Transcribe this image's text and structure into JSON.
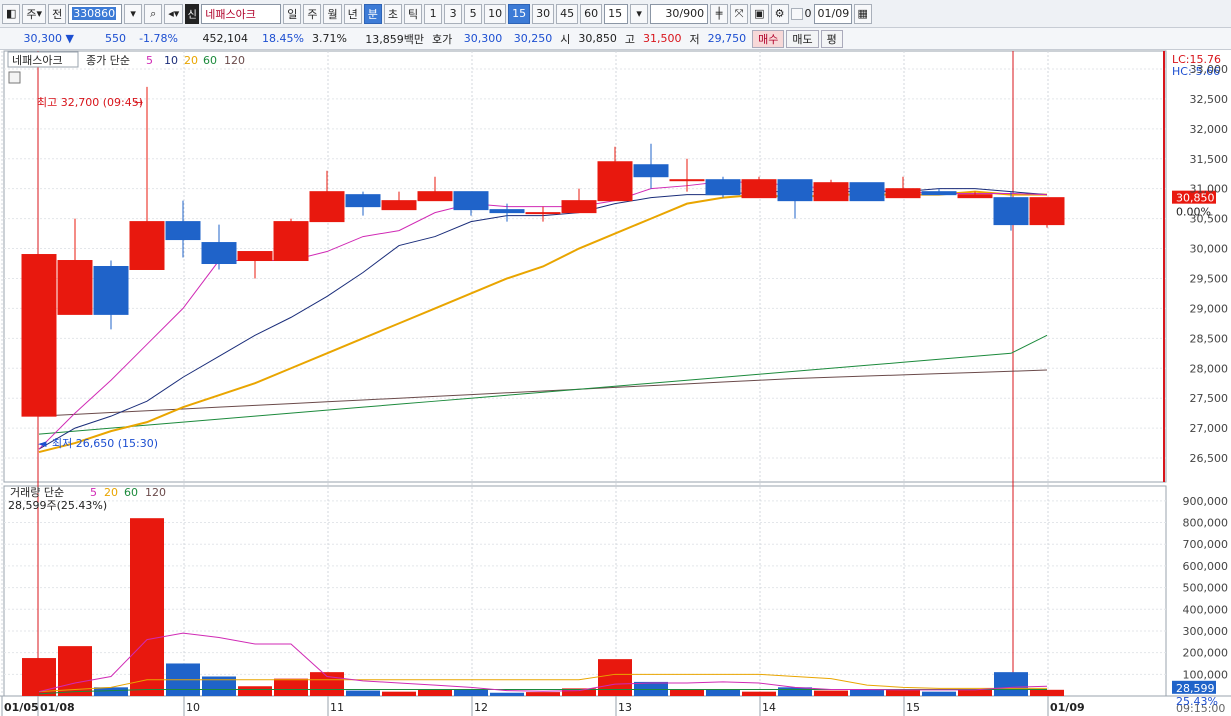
{
  "toolbar": {
    "mode": "주",
    "prev_label": "전",
    "code": "330860",
    "shin": "신",
    "name": "네패스아크",
    "periods": [
      "일",
      "주",
      "월",
      "년",
      "분",
      "초",
      "틱"
    ],
    "selected_period": "분",
    "minutes": [
      "1",
      "3",
      "5",
      "10",
      "15",
      "30",
      "45",
      "60"
    ],
    "selected_minute": "15",
    "interval_value": "15",
    "count": "30",
    "count_total": "/900",
    "date": "01/09",
    "checkbox_label": "0"
  },
  "quote": {
    "price": "30,300",
    "change": "550",
    "change_pct": "-1.78%",
    "volume": "452,104",
    "turnover_pct": "18.45%",
    "pct2": "3.71%",
    "amount": "13,859백만",
    "hoga_label": "호가",
    "ask": "30,300",
    "bid": "30,250",
    "open_label": "시",
    "open": "30,850",
    "high_label": "고",
    "high": "31,500",
    "low_label": "저",
    "low": "29,750",
    "buy": "매수",
    "sell": "매도",
    "avg": "평"
  },
  "price_panel": {
    "stock_tag": "네패스아크",
    "legend_prefix": "종가 단순",
    "ma_periods": [
      "5",
      "10",
      "20",
      "60",
      "120"
    ],
    "lc": "LC:15.76",
    "hc": "HC:-5.66",
    "max_label": "최고 32,700 (09:45)",
    "min_label": "최저 26,650 (15:30)",
    "current_price": "30,850",
    "current_pct": "0.00%",
    "y_ticks": [
      "33,000",
      "32,500",
      "32,000",
      "31,500",
      "31,000",
      "30,500",
      "30,000",
      "29,500",
      "29,000",
      "28,500",
      "28,000",
      "27,500",
      "27,000",
      "26,500"
    ]
  },
  "volume_panel": {
    "legend_prefix": "거래량 단순",
    "ma_periods": [
      "5",
      "20",
      "60",
      "120"
    ],
    "current": "28,599주(25.43%)",
    "last_value": "28,599",
    "last_pct": "25.43%",
    "y_ticks": [
      "900,000",
      "800,000",
      "700,000",
      "600,000",
      "500,000",
      "400,000",
      "300,000",
      "200,000",
      "100,000"
    ]
  },
  "x_axis": {
    "labels": [
      "01/05",
      "01/08",
      "10",
      "11",
      "12",
      "13",
      "14",
      "15",
      "01/09"
    ],
    "right_time": "09:15:00"
  },
  "colors": {
    "up": "#e8180e",
    "down": "#1f63c9",
    "ma5": "#d02ab5",
    "ma10": "#1a2d7a",
    "ma20": "#e9a500",
    "ma60": "#1c8a3c",
    "ma120": "#6b4b4b"
  },
  "chart_data": {
    "type": "candlestick",
    "candles": [
      {
        "o": 27200,
        "h": 27200,
        "l": 27200,
        "c": 29900
      },
      {
        "o": 28900,
        "h": 30500,
        "l": 28900,
        "c": 29800
      },
      {
        "o": 29700,
        "h": 29800,
        "l": 28650,
        "c": 28900
      },
      {
        "o": 29650,
        "h": 32700,
        "l": 29650,
        "c": 30450
      },
      {
        "o": 30450,
        "h": 30800,
        "l": 29850,
        "c": 30150
      },
      {
        "o": 30100,
        "h": 30400,
        "l": 29650,
        "c": 29750
      },
      {
        "o": 29800,
        "h": 29900,
        "l": 29500,
        "c": 29950
      },
      {
        "o": 29800,
        "h": 30500,
        "l": 29800,
        "c": 30450
      },
      {
        "o": 30450,
        "h": 31300,
        "l": 30450,
        "c": 30950
      },
      {
        "o": 30900,
        "h": 30950,
        "l": 30550,
        "c": 30700
      },
      {
        "o": 30650,
        "h": 30950,
        "l": 30650,
        "c": 30800
      },
      {
        "o": 30800,
        "h": 31200,
        "l": 30800,
        "c": 30950
      },
      {
        "o": 30950,
        "h": 30950,
        "l": 30550,
        "c": 30650
      },
      {
        "o": 30650,
        "h": 30750,
        "l": 30450,
        "c": 30600
      },
      {
        "o": 30600,
        "h": 30700,
        "l": 30450,
        "c": 30600
      },
      {
        "o": 30600,
        "h": 31000,
        "l": 30600,
        "c": 30800
      },
      {
        "o": 30800,
        "h": 31700,
        "l": 30800,
        "c": 31450
      },
      {
        "o": 31400,
        "h": 31750,
        "l": 31000,
        "c": 31200
      },
      {
        "o": 31150,
        "h": 31500,
        "l": 30950,
        "c": 31150
      },
      {
        "o": 31150,
        "h": 31200,
        "l": 30850,
        "c": 30900
      },
      {
        "o": 30850,
        "h": 31200,
        "l": 30850,
        "c": 31150
      },
      {
        "o": 31150,
        "h": 31150,
        "l": 30500,
        "c": 30800
      },
      {
        "o": 30800,
        "h": 31150,
        "l": 30800,
        "c": 31100
      },
      {
        "o": 31100,
        "h": 31100,
        "l": 30800,
        "c": 30800
      },
      {
        "o": 30850,
        "h": 31200,
        "l": 30850,
        "c": 31000
      },
      {
        "o": 30950,
        "h": 31000,
        "l": 30900,
        "c": 30900
      },
      {
        "o": 30850,
        "h": 30950,
        "l": 30850,
        "c": 30900
      },
      {
        "o": 30850,
        "h": 30950,
        "l": 30300,
        "c": 30400
      },
      {
        "o": 30400,
        "h": 30850,
        "l": 30350,
        "c": 30850
      }
    ],
    "volumes": [
      175000,
      230000,
      40000,
      820000,
      150000,
      90000,
      45000,
      80000,
      110000,
      25000,
      20000,
      30000,
      30000,
      15000,
      18000,
      35000,
      170000,
      65000,
      30000,
      30000,
      20000,
      40000,
      25000,
      30000,
      30000,
      20000,
      28000,
      110000,
      28599
    ],
    "ma5": [
      26650,
      27250,
      27800,
      28400,
      29000,
      29800,
      29800,
      29800,
      29950,
      30200,
      30300,
      30600,
      30750,
      30700,
      30700,
      30700,
      30800,
      31000,
      31050,
      31120,
      31100,
      31050,
      31000,
      31000,
      30950,
      30920,
      30920,
      30920,
      30900
    ],
    "ma10": [
      26650,
      27000,
      27200,
      27450,
      27850,
      28200,
      28550,
      28850,
      29200,
      29600,
      30050,
      30200,
      30450,
      30550,
      30550,
      30600,
      30750,
      30850,
      30900,
      30900,
      30950,
      30950,
      30950,
      30950,
      30950,
      31000,
      31000,
      30950,
      30900
    ],
    "ma20": [
      26600,
      26750,
      26950,
      27100,
      27350,
      27550,
      27750,
      28000,
      28250,
      28500,
      28750,
      29000,
      29250,
      29500,
      29700,
      30000,
      30250,
      30500,
      30750,
      30850,
      30900,
      30850,
      30900,
      30900,
      30900,
      30900,
      30950,
      30900,
      30900
    ],
    "ma60": [
      26900,
      26950,
      27000,
      27050,
      27100,
      27150,
      27200,
      27250,
      27300,
      27350,
      27400,
      27450,
      27500,
      27550,
      27600,
      27650,
      27700,
      27750,
      27800,
      27850,
      27900,
      27950,
      28000,
      28050,
      28100,
      28150,
      28200,
      28250,
      28550
    ],
    "ma120": [
      27200,
      27230,
      27260,
      27290,
      27320,
      27350,
      27380,
      27410,
      27440,
      27470,
      27500,
      27530,
      27560,
      27590,
      27620,
      27650,
      27680,
      27710,
      27740,
      27770,
      27800,
      27830,
      27850,
      27870,
      27890,
      27910,
      27930,
      27950,
      27970
    ],
    "vol_ma5": [
      20000,
      60000,
      90000,
      260000,
      290000,
      270000,
      240000,
      240000,
      90000,
      70000,
      60000,
      50000,
      40000,
      25000,
      22000,
      25000,
      55000,
      60000,
      60000,
      65000,
      60000,
      40000,
      30000,
      30000,
      28000,
      28000,
      28000,
      40000,
      45000
    ],
    "vol_ma20": [
      20000,
      30000,
      40000,
      75000,
      75000,
      75000,
      75000,
      75000,
      75000,
      75000,
      75000,
      75000,
      75000,
      75000,
      75000,
      75000,
      100000,
      100000,
      100000,
      100000,
      100000,
      90000,
      80000,
      50000,
      40000,
      35000,
      35000,
      35000,
      35000
    ],
    "vol_ma60": [
      10000,
      20000,
      25000,
      30000,
      30000,
      30000,
      30000,
      30000,
      30000,
      30000,
      30000,
      30000,
      30000,
      30000,
      30000,
      30000,
      30000,
      30000,
      30000,
      30000,
      30000,
      30000,
      30000,
      30000,
      30000,
      30000,
      30000,
      30000,
      30000
    ]
  }
}
